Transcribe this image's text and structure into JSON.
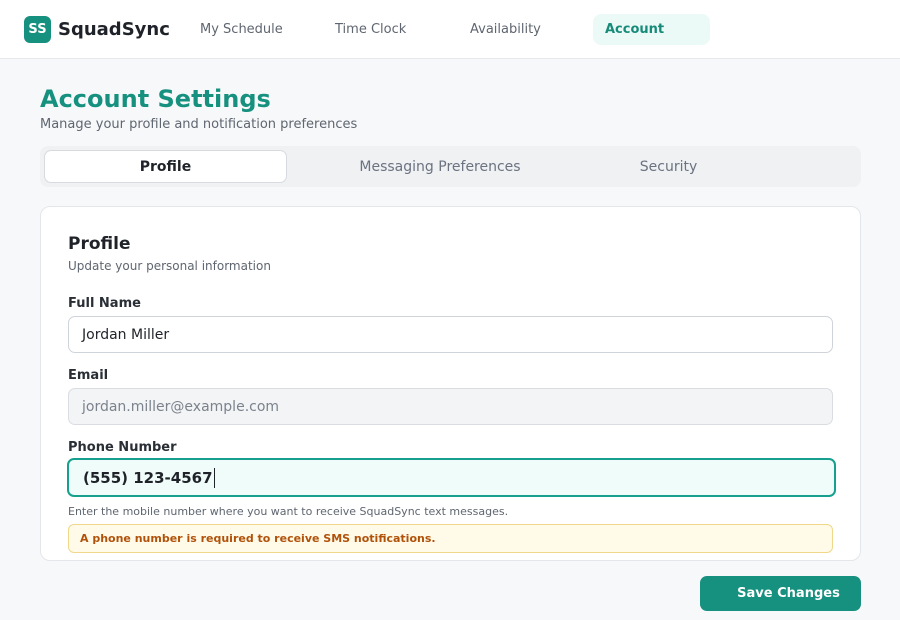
{
  "brand": {
    "badge": "SS",
    "name": "SquadSync",
    "accent": "#17917f"
  },
  "nav": {
    "items": [
      {
        "label": "My Schedule"
      },
      {
        "label": "Time Clock"
      },
      {
        "label": "Availability"
      },
      {
        "label": "Account",
        "active": true
      }
    ]
  },
  "header": {
    "title": "Account Settings",
    "subtitle": "Manage your profile and notification preferences"
  },
  "tabs": [
    {
      "label": "Profile",
      "active": true
    },
    {
      "label": "Messaging Preferences"
    },
    {
      "label": "Security"
    }
  ],
  "profile_card": {
    "title": "Profile",
    "subtitle": "Update your personal information",
    "fields": {
      "full_name": {
        "label": "Full Name",
        "value": "Jordan Miller"
      },
      "email": {
        "label": "Email",
        "value": "jordan.miller@example.com",
        "disabled": true
      },
      "phone": {
        "label": "Phone Number",
        "value": "(555) 123-4567",
        "focused": true
      }
    },
    "help_text": "Enter the mobile number where you want to receive SquadSync text messages.",
    "warning": "A phone number is required to receive SMS notifications.",
    "warning_color": "#b1520b"
  },
  "actions": {
    "save_label": "Save Changes"
  }
}
